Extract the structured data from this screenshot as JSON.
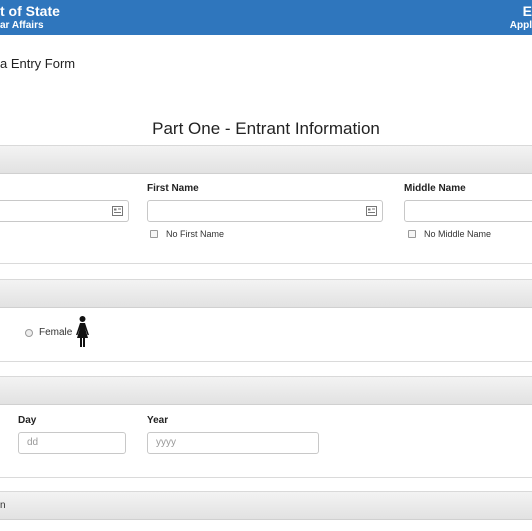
{
  "header": {
    "dept_title": "t of State",
    "dept_subtitle": "ar Affairs",
    "right_title": "E",
    "right_subtitle": "Appl"
  },
  "form_title": "a Entry Form",
  "part_heading": "Part One - Entrant Information",
  "name_section": {
    "first_name_label": "First Name",
    "first_name_value": "",
    "middle_name_label": "Middle Name",
    "middle_name_value": "",
    "no_first_name_label": "No First Name",
    "no_middle_name_label": "No Middle Name"
  },
  "gender_section": {
    "female_label": "Female",
    "female_icon": "female-person-icon"
  },
  "birth_section": {
    "day_label": "Day",
    "day_placeholder": "dd",
    "year_label": "Year",
    "year_placeholder": "yyyy"
  },
  "next_section_label": "n",
  "colors": {
    "header_bg": "#2f76bd",
    "section_bar": "#e9e9e9"
  }
}
